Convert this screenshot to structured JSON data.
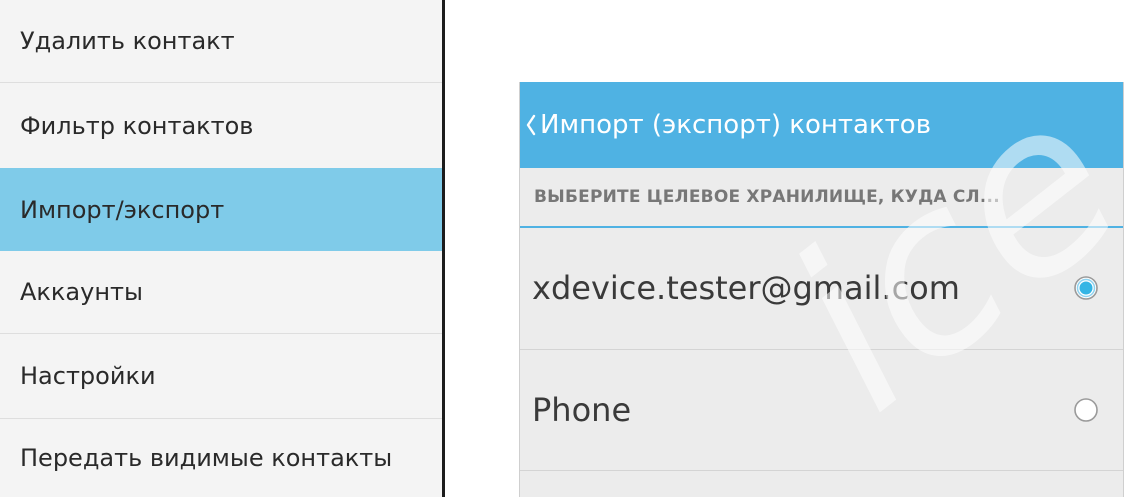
{
  "header_fragment": "",
  "menu": {
    "items": [
      {
        "label": "Удалить контакт"
      },
      {
        "label": "Фильтр контактов"
      },
      {
        "label": "Импорт/экспорт",
        "selected": true
      },
      {
        "label": "Аккаунты"
      },
      {
        "label": "Настройки"
      },
      {
        "label": "Передать видимые контакты"
      }
    ]
  },
  "dialog": {
    "title": "Импорт (экспорт) контактов",
    "section_header": "ВЫБЕРИТЕ ЦЕЛЕВОЕ ХРАНИЛИЩЕ, КУДА СЛ...",
    "accounts": [
      {
        "label": "xdevice.tester@gmail.com",
        "checked": true
      },
      {
        "label": "Phone",
        "checked": false
      }
    ],
    "watermark": "ice"
  },
  "colors": {
    "accent": "#4fb2e3",
    "menu_selected": "#7fcbe9",
    "radio_checked": "#33b5e5"
  }
}
